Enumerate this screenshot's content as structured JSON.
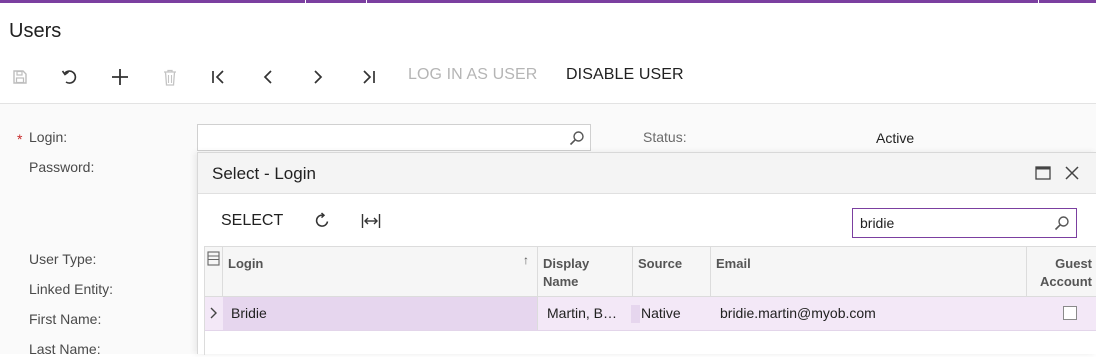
{
  "page": {
    "title": "Users"
  },
  "toolbar": {
    "log_in_as_user": "LOG IN AS USER",
    "disable_user": "DISABLE USER"
  },
  "form": {
    "login_label": "Login:",
    "password_label": "Password:",
    "user_type_label": "User Type:",
    "linked_entity_label": "Linked Entity:",
    "first_name_label": "First Name:",
    "last_name_label": "Last Name:",
    "status_label": "Status:",
    "status_value": "Active",
    "login_value": ""
  },
  "dialog": {
    "title": "Select - Login",
    "select_label": "SELECT",
    "search_value": "bridie",
    "columns": {
      "login": "Login",
      "display_name": "Display Name",
      "source": "Source",
      "email": "Email",
      "guest_account": "Guest Account"
    },
    "rows": [
      {
        "login": "Bridie",
        "display_name": "Martin, B…",
        "source": "Native",
        "email": "bridie.martin@myob.com",
        "guest_account": false
      }
    ]
  },
  "colors": {
    "accent": "#7b3fa0",
    "row_selected": "#f3e8f7",
    "required": "#c62828"
  },
  "icons": [
    "save-icon",
    "undo-icon",
    "add-icon",
    "delete-icon",
    "first-icon",
    "previous-icon",
    "next-icon",
    "last-icon",
    "search-icon",
    "maximize-icon",
    "close-icon",
    "refresh-icon",
    "fit-columns-icon",
    "column-chooser-icon",
    "chevron-right-icon"
  ]
}
